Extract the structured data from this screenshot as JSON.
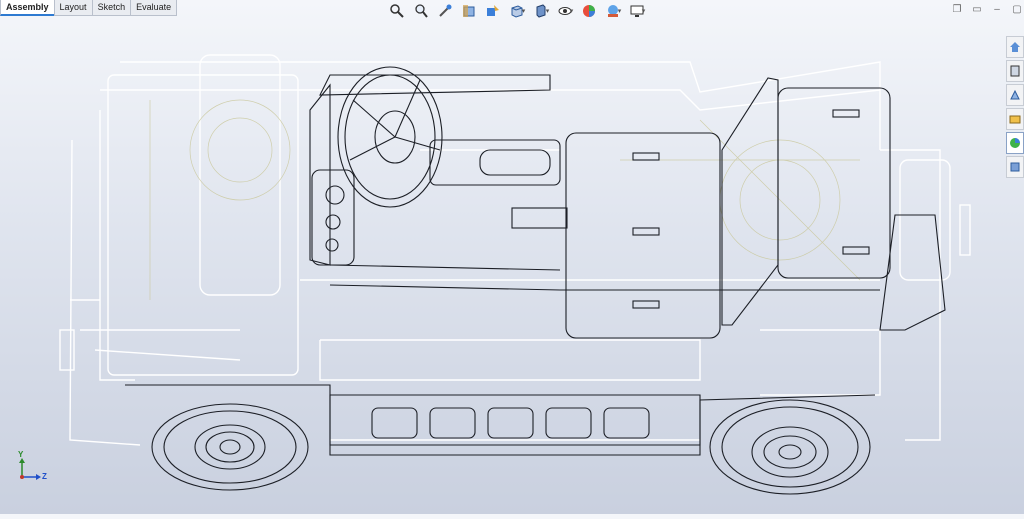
{
  "tabs": [
    "Assembly",
    "Layout",
    "Sketch",
    "Evaluate"
  ],
  "active_tab": "Assembly",
  "heads_up_toolbar": [
    {
      "icon": "zoom-to-fit-icon"
    },
    {
      "icon": "zoom-to-area-icon"
    },
    {
      "icon": "previous-view-icon"
    },
    {
      "icon": "section-view-icon"
    },
    {
      "icon": "dynamic-annotation-icon"
    },
    {
      "icon": "view-orientation-icon",
      "dropdown": true
    },
    {
      "icon": "display-style-icon",
      "dropdown": true
    },
    {
      "icon": "hide-show-items-icon",
      "dropdown": true
    },
    {
      "icon": "edit-appearance-icon"
    },
    {
      "icon": "apply-scene-icon",
      "dropdown": true
    },
    {
      "icon": "view-settings-icon",
      "dropdown": true
    }
  ],
  "task_pane": [
    {
      "icon": "home-icon"
    },
    {
      "icon": "resources-icon"
    },
    {
      "icon": "design-library-icon"
    },
    {
      "icon": "file-explorer-icon"
    },
    {
      "icon": "view-palette-icon",
      "active": true
    },
    {
      "icon": "appearances-icon"
    }
  ],
  "triad": {
    "y_label": "Y",
    "z_label": "Z"
  },
  "colors": {
    "accent": "#2e7ad1",
    "model_line": "#1c1f26",
    "hidden_line": "#ffffff",
    "triad_y": "#2b8a2b",
    "triad_z": "#1f4fc9"
  }
}
